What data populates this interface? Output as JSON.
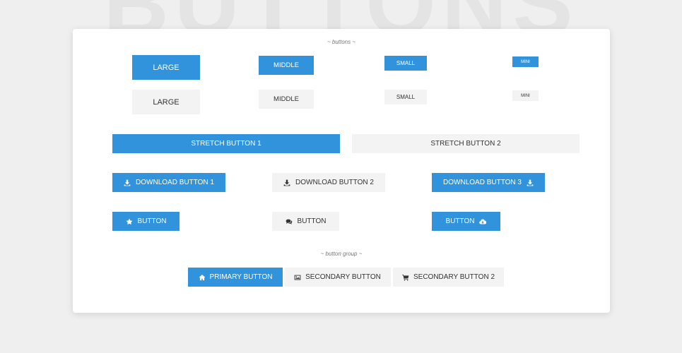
{
  "background_title": "BUTTONS",
  "sections": {
    "buttons_label": "~ buttons ~",
    "group_label": "~ button group ~"
  },
  "sizes": {
    "primary": [
      "LARGE",
      "MIDDLE",
      "SMALL",
      "MINI"
    ],
    "secondary": [
      "LARGE",
      "MIDDLE",
      "SMALL",
      "MINI"
    ]
  },
  "stretch": [
    "STRETCH BUTTON 1",
    "STRETCH BUTTON 2"
  ],
  "download": [
    {
      "label": "DOWNLOAD BUTTON 1",
      "icon": "download-icon"
    },
    {
      "label": "DOWNLOAD BUTTON 2",
      "icon": "download-icon"
    },
    {
      "label": "DOWNLOAD BUTTON 3",
      "icon": "download-icon"
    }
  ],
  "icon_buttons": [
    {
      "label": "BUTTON",
      "icon": "star-icon"
    },
    {
      "label": "BUTTON",
      "icon": "comments-icon"
    },
    {
      "label": "BUTTON",
      "icon": "cloud-download-icon"
    }
  ],
  "group": [
    {
      "label": "PRIMARY BUTTON",
      "icon": "home-icon"
    },
    {
      "label": "SECONDARY BUTTON",
      "icon": "image-icon"
    },
    {
      "label": "SECONDARY BUTTON 2",
      "icon": "cart-icon"
    }
  ],
  "colors": {
    "primary": "#3193dc",
    "secondary": "#f3f3f3",
    "background": "#efefef"
  }
}
